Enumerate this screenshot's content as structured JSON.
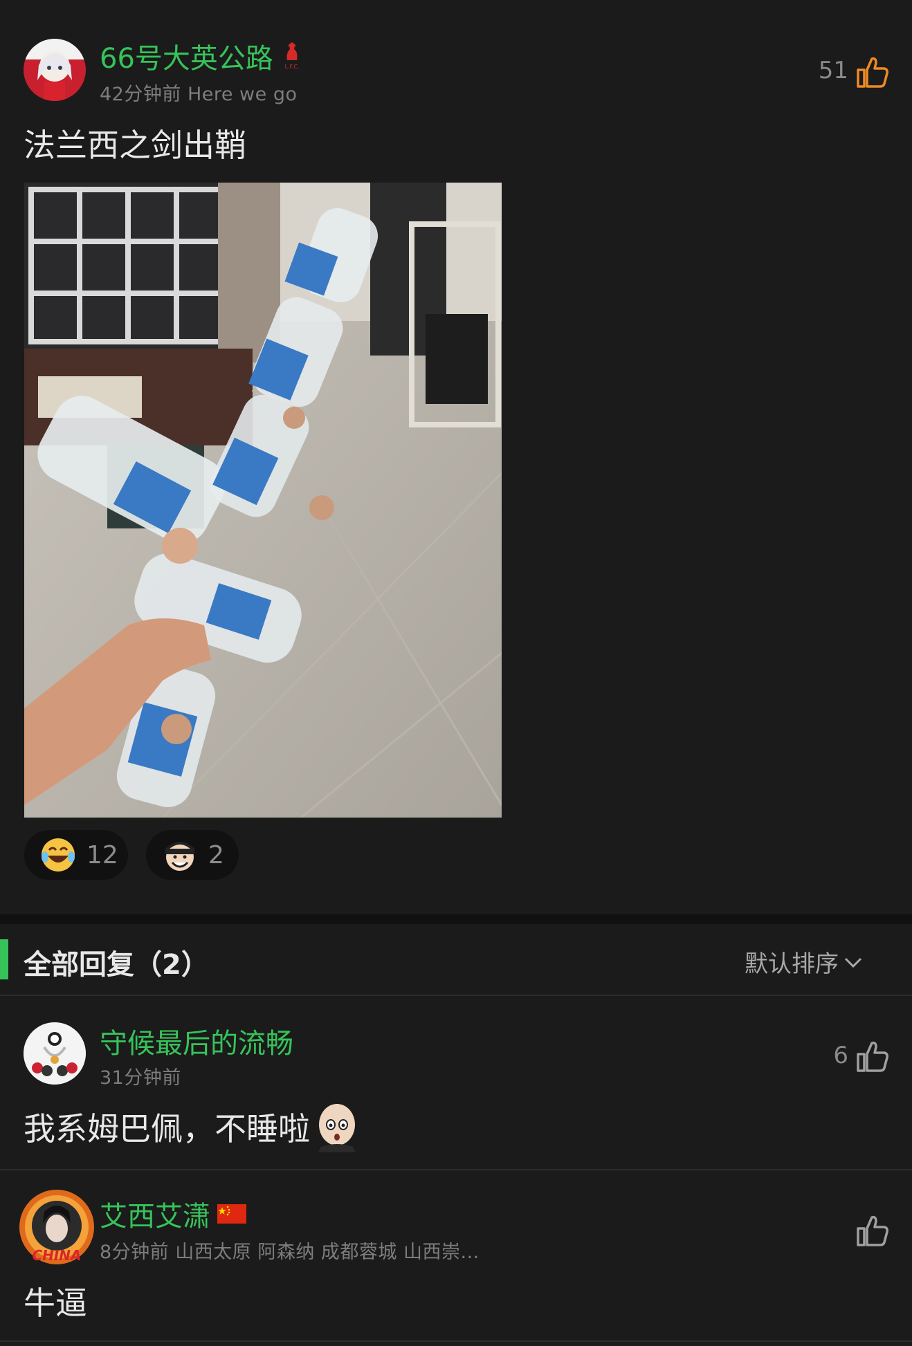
{
  "post": {
    "author": "66号大英公路",
    "meta": "42分钟前 Here we go",
    "likes": "51",
    "text": "法兰西之剑出鞘",
    "reactions": [
      {
        "icon": "laughing-tears-emoji",
        "count": "12"
      },
      {
        "icon": "cartoon-face-sticker",
        "count": "2"
      }
    ]
  },
  "replies_header": {
    "title": "全部回复（2）",
    "sort_label": "默认排序"
  },
  "replies": [
    {
      "author": "守候最后的流畅",
      "meta": "31分钟前",
      "likes": "6",
      "text": "我系姆巴佩，不睡啦"
    },
    {
      "author": "艾西艾潇",
      "meta": "8分钟前 山西太原 阿森纳 成都蓉城 山西崇...",
      "likes": "",
      "text": "牛逼"
    }
  ],
  "colors": {
    "background": "#1b1b1b",
    "username": "#36c35a",
    "accent_bar": "#36c35a",
    "like_active": "#f08a24",
    "like_idle": "#a0a0a0"
  }
}
